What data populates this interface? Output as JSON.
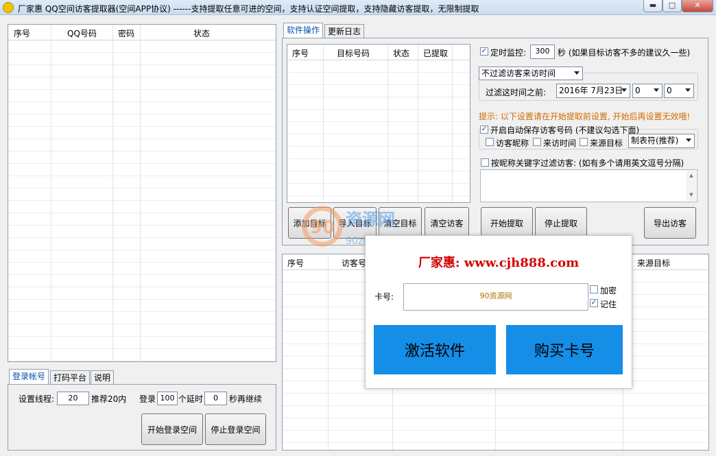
{
  "window": {
    "title": "厂家惠  QQ空间访客提取器(空间APP协议) ------支持提取任意可进的空间，支持认证空间提取，支持隐藏访客提取，无限制提取",
    "min_label": "▬",
    "max_label": "□",
    "close_label": "✕"
  },
  "left_table": {
    "columns": [
      "序号",
      "QQ号码",
      "密码",
      "状态"
    ]
  },
  "login_tabs": [
    "登录帐号",
    "打码平台",
    "说明"
  ],
  "login_panel": {
    "threads_label": "设置线程:",
    "threads_value": "20",
    "threads_hint": "推荐20内",
    "login_label": "登录",
    "login_value": "100",
    "delay_label": "个延时",
    "delay_value": "0",
    "continue_label": "秒再继续",
    "start_login": "开始登录空间",
    "stop_login": "停止登录空间"
  },
  "right_tabs": [
    "软件操作",
    "更新日志"
  ],
  "target_table": {
    "columns": [
      "序号",
      "目标号码",
      "状态",
      "已提取"
    ]
  },
  "target_buttons": [
    "添加目标",
    "导入目标",
    "清空目标",
    "清空访客"
  ],
  "settings": {
    "monitor_label": "定时监控:",
    "monitor_value": "300",
    "monitor_hint": "秒 (如果目标访客不多的建议久一些)",
    "filter_select": "不过滤访客来访时间",
    "filter_before_label": "过滤这时间之前:",
    "date_value": "2016年 7月23日",
    "hour_value": "0",
    "minute_value": "0",
    "tip": "提示: 以下设置请在开始提取前设置, 开始后再设置无效哦!",
    "autosave_label": "开启自动保存访客号码 (不建议勾选下面)",
    "opt_nickname": "访客昵称",
    "opt_time": "来访时间",
    "opt_source": "来源目标",
    "separator_select": "制表符(推荐)",
    "keyword_label": "按昵称关键字过滤访客: (如有多个请用英文逗号分隔)"
  },
  "action_buttons": [
    "开始提取",
    "停止提取",
    "导出访客"
  ],
  "visitor_table": {
    "columns": [
      "序号",
      "访客号",
      "来源目标"
    ]
  },
  "dialog": {
    "title": "厂家惠: www.cjh888.com",
    "card_label": "卡号:",
    "card_value": "90资源网",
    "encrypt_label": "加密",
    "remember_label": "记住",
    "activate_label": "激活软件",
    "buy_label": "购买卡号"
  },
  "watermark": {
    "cn": "资源网",
    "num": "90",
    "en": "90ziyuan.com"
  },
  "colors": {
    "accent": "#158ee8",
    "tip": "#d46a00",
    "dialog_title": "#d40000"
  }
}
